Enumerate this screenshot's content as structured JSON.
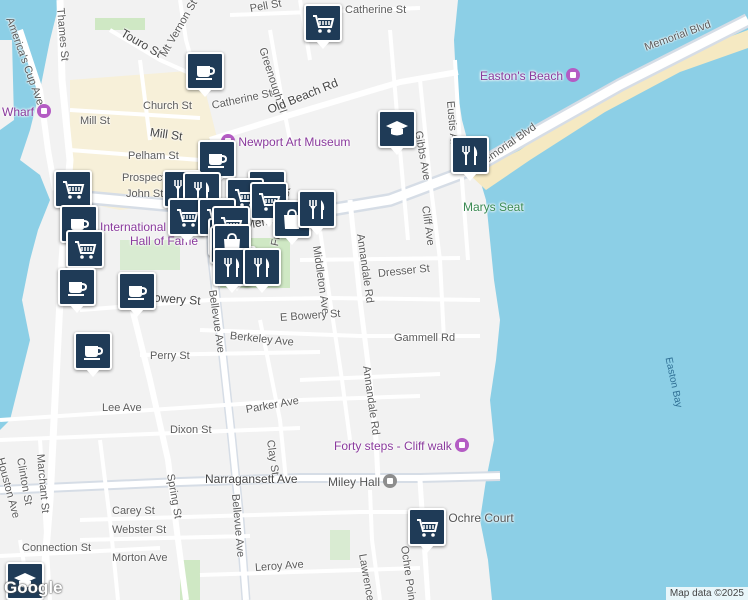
{
  "map": {
    "colors": {
      "water": "#8ccfe6",
      "land": "#f2f2f2",
      "road": "#ffffff",
      "major_road": "#d6dde6",
      "park": "#cfe8c4",
      "beach": "#f5e9c2",
      "downtown": "#fbefc5",
      "marker": "#1f3b57"
    },
    "streets": [
      {
        "id": "thames-st",
        "label": "Thames St"
      },
      {
        "id": "americas-cup-ave",
        "label": "America's Cup Ave"
      },
      {
        "id": "touro-st",
        "label": "Touro St"
      },
      {
        "id": "mt-vernon-st",
        "label": "Mt Vernon St"
      },
      {
        "id": "pell-st",
        "label": "Pell St"
      },
      {
        "id": "catherine-st-top",
        "label": "Catherine St"
      },
      {
        "id": "memorial-blvd-east",
        "label": "Memorial Blvd"
      },
      {
        "id": "greenough-pl",
        "label": "Greenough Pl"
      },
      {
        "id": "old-beach-rd",
        "label": "Old Beach Rd"
      },
      {
        "id": "catherine-st",
        "label": "Catherine St"
      },
      {
        "id": "church-st",
        "label": "Church St"
      },
      {
        "id": "mill-st-west",
        "label": "Mill St"
      },
      {
        "id": "mill-st",
        "label": "Mill St"
      },
      {
        "id": "eustis-ave",
        "label": "Eustis Ave"
      },
      {
        "id": "gibbs-ave",
        "label": "Gibbs Ave"
      },
      {
        "id": "memorial-blvd-mid",
        "label": "Memorial Blvd"
      },
      {
        "id": "pelham-st",
        "label": "Pelham St"
      },
      {
        "id": "prospect-hill",
        "label": "Prospect"
      },
      {
        "id": "john-st",
        "label": "John St"
      },
      {
        "id": "cliff-ave",
        "label": "Cliff Ave"
      },
      {
        "id": "memorial-blvd-w",
        "label": "Memorial Blvd"
      },
      {
        "id": "annandale-rd-north",
        "label": "Annandale Rd"
      },
      {
        "id": "freebody-st",
        "label": "Freebody St"
      },
      {
        "id": "middleton-ave",
        "label": "Middleton Ave"
      },
      {
        "id": "dresser-st",
        "label": "Dresser St"
      },
      {
        "id": "bowery-st",
        "label": "Bowery St"
      },
      {
        "id": "bellevue-ave-north",
        "label": "Bellevue Ave"
      },
      {
        "id": "e-bowery-st",
        "label": "E Bowery St"
      },
      {
        "id": "gammell-rd",
        "label": "Gammell Rd"
      },
      {
        "id": "berkeley-ave",
        "label": "Berkeley Ave"
      },
      {
        "id": "perry-st",
        "label": "Perry St"
      },
      {
        "id": "annandale-rd-south",
        "label": "Annandale Rd"
      },
      {
        "id": "lee-ave",
        "label": "Lee Ave"
      },
      {
        "id": "parker-ave",
        "label": "Parker Ave"
      },
      {
        "id": "dixon-st",
        "label": "Dixon St"
      },
      {
        "id": "clay-st",
        "label": "Clay St"
      },
      {
        "id": "marchant-st",
        "label": "Marchant St"
      },
      {
        "id": "clinton-st",
        "label": "Clinton St"
      },
      {
        "id": "houston-ave",
        "label": "Houston Ave"
      },
      {
        "id": "narragansett-ave",
        "label": "Narragansett Ave"
      },
      {
        "id": "spring-st",
        "label": "Spring St"
      },
      {
        "id": "bellevue-ave-south",
        "label": "Bellevue Ave"
      },
      {
        "id": "carey-st",
        "label": "Carey St"
      },
      {
        "id": "webster-st",
        "label": "Webster St"
      },
      {
        "id": "connection-st",
        "label": "Connection St"
      },
      {
        "id": "morton-ave",
        "label": "Morton Ave"
      },
      {
        "id": "leroy-ave",
        "label": "Leroy Ave"
      },
      {
        "id": "lawrence-ave",
        "label": "Lawrence Av"
      },
      {
        "id": "ochre-point-ave",
        "label": "Ochre Point Ave"
      }
    ],
    "water_labels": [
      {
        "id": "easton-bay",
        "label": "Easton Bay"
      }
    ],
    "pois": [
      {
        "id": "eastons-beach",
        "label": "Easton's Beach",
        "color": "purple"
      },
      {
        "id": "wharf",
        "label": "Wharf",
        "color": "purple"
      },
      {
        "id": "newport-art-museum",
        "label": "Newport Art Museum",
        "color": "purple"
      },
      {
        "id": "international-hall-of-fame",
        "label": "International",
        "label2": "Hall of Fame",
        "color": "purple"
      },
      {
        "id": "marys-seat",
        "label": "Marys Seat",
        "color": "green"
      },
      {
        "id": "forty-steps",
        "label": "Forty steps - Cliff walk",
        "color": "purple"
      },
      {
        "id": "miley-hall",
        "label": "Miley Hall",
        "color": "gray"
      },
      {
        "id": "ochre-court",
        "label": "Ochre Court",
        "color": "gray"
      }
    ],
    "markers": [
      {
        "type": "grocery"
      },
      {
        "type": "coffee"
      },
      {
        "type": "school"
      },
      {
        "type": "restaurant"
      },
      {
        "type": "coffee"
      },
      {
        "type": "restaurant"
      },
      {
        "type": "restaurant"
      },
      {
        "type": "grocery"
      },
      {
        "type": "grocery"
      },
      {
        "type": "grocery"
      },
      {
        "type": "coffee"
      },
      {
        "type": "grocery"
      },
      {
        "type": "grocery"
      },
      {
        "type": "grocery"
      },
      {
        "type": "grocery"
      },
      {
        "type": "shopping"
      },
      {
        "type": "restaurant"
      },
      {
        "type": "grocery"
      },
      {
        "type": "grocery"
      },
      {
        "type": "grocery"
      },
      {
        "type": "grocery"
      },
      {
        "type": "shopping"
      },
      {
        "type": "restaurant"
      },
      {
        "type": "restaurant"
      },
      {
        "type": "coffee"
      },
      {
        "type": "coffee"
      },
      {
        "type": "coffee"
      },
      {
        "type": "grocery"
      },
      {
        "type": "school"
      }
    ],
    "logo": "Google",
    "attribution": "Map data ©2025"
  }
}
